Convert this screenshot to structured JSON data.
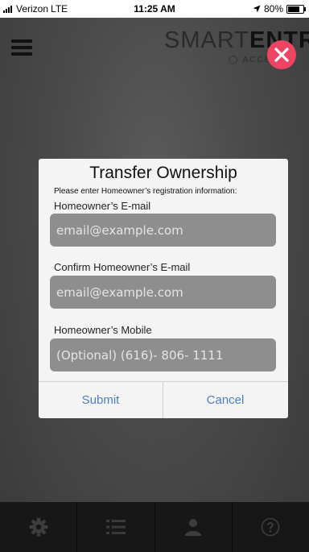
{
  "status_bar": {
    "carrier": "Verizon",
    "network": "LTE",
    "time": "11:25 AM",
    "battery": "80%",
    "battery_level": 0.8
  },
  "header": {
    "logo_part1": "SMART",
    "logo_part2": "ENTRY",
    "logo_sub": "ACCESS"
  },
  "dialog": {
    "title": "Transfer Ownership",
    "subtitle": "Please enter Homeowner’s registration information:",
    "fields": [
      {
        "label": "Homeowner’s E-mail",
        "placeholder": "email@example.com",
        "value": ""
      },
      {
        "label": "Confirm Homeowner’s E-mail",
        "placeholder": "email@example.com",
        "value": ""
      },
      {
        "label": "Homeowner’s Mobile",
        "placeholder": "(Optional) (616)- 806- 1111",
        "value": ""
      }
    ],
    "submit_label": "Submit",
    "cancel_label": "Cancel"
  },
  "tabbar": {
    "tabs": [
      {
        "icon": "gear-icon"
      },
      {
        "icon": "list-icon"
      },
      {
        "icon": "person-icon"
      },
      {
        "icon": "help-icon"
      }
    ]
  },
  "colors": {
    "close_button": "#ef4563",
    "dialog_button_text": "#4b7fc9",
    "input_background": "#8e8e8e",
    "tabbar_background": "#171717"
  }
}
